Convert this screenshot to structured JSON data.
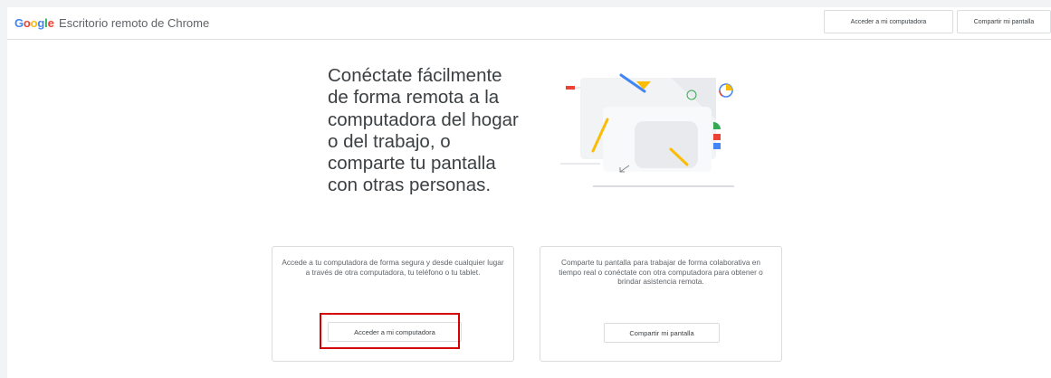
{
  "app": {
    "brand_google": "Google",
    "brand_product": "Escritorio remoto de Chrome"
  },
  "header": {
    "access_button": "Acceder a mi computadora",
    "share_button": "Compartir mi pantalla"
  },
  "hero": {
    "lines": [
      "Conéctate fácilmente",
      "de forma remota a la",
      "computadora del hogar",
      "o del trabajo, o",
      "comparte tu pantalla",
      "con otras personas."
    ]
  },
  "cards": [
    {
      "description": "Accede a tu computadora de forma segura y desde cualquier lugar a través de otra computadora, tu teléfono o tu tablet.",
      "button": "Acceder a mi computadora"
    },
    {
      "description": "Comparte tu pantalla para trabajar de forma colaborativa en tiempo real o conéctate con otra computadora para obtener o brindar asistencia remota.",
      "button": "Compartir mi pantalla"
    }
  ],
  "colors": {
    "google_blue": "#4285f4",
    "google_red": "#ea4335",
    "google_yellow": "#fbbc05",
    "google_green": "#34a853",
    "highlight_red": "#d50000"
  }
}
